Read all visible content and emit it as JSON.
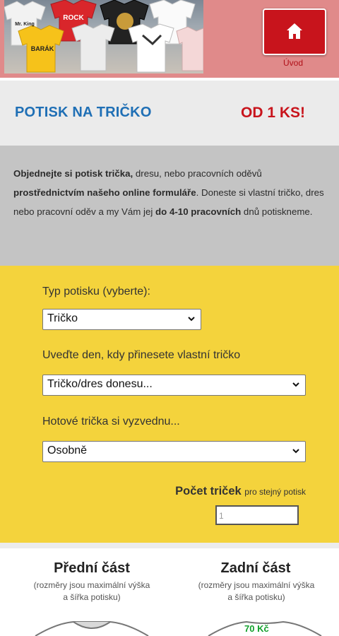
{
  "header": {
    "home_label": "Úvod",
    "shirt_prints": [
      "Mr. King",
      "ROCK",
      "BARÁK"
    ]
  },
  "title": {
    "left": "POTISK NA TRIČKO",
    "right": "OD 1 KS!"
  },
  "info": {
    "part1_bold": "Objednejte si potisk trička,",
    "part2": " dresu, nebo pracovních oděvů ",
    "part3_bold": "prostřednictvím našeho online formuláře",
    "part4": ". Doneste si vlastní tričko, dres nebo pracovní oděv a my Vám jej ",
    "part5_bold": "do 4-10 pracovních",
    "part6": " dnů potiskneme."
  },
  "form": {
    "type_label": "Typ potisku (vyberte):",
    "type_value": "Tričko",
    "day_label": "Uveďte den, kdy přinesete vlastní tričko",
    "day_value": "Tričko/dres donesu...",
    "pickup_label": "Hotové trička si vyzvednu...",
    "pickup_value": "Osobně",
    "count_label_bold": "Počet triček",
    "count_label_small": "pro stejný potisk",
    "count_value": "1"
  },
  "sides": {
    "front_title": "Přední část",
    "front_sub1": "(rozměry jsou maximální výška",
    "front_sub2": "a šířka potisku)",
    "back_title": "Zadní část",
    "back_sub1": "(rozměry jsou maximální výška",
    "back_sub2": "a šířka potisku)",
    "back_price": "70 Kč"
  },
  "colors": {
    "header_bg": "#e08a8a",
    "home_button": "#c8141c",
    "title_blue": "#1f6fb5",
    "title_red": "#c8141c",
    "info_bg": "#c4c4c4",
    "form_bg": "#f4d33c",
    "price_green": "#12a02c"
  }
}
